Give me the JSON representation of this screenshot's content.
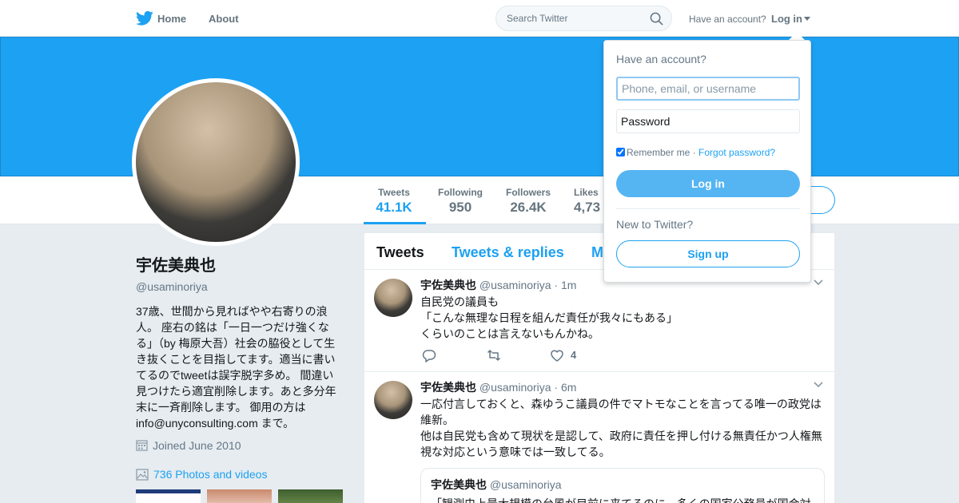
{
  "colors": {
    "brand": "#1da1f2",
    "banner": "#1da1f2",
    "text": "#14171a",
    "muted": "#657786"
  },
  "nav": {
    "logo_icon": "twitter-bird-icon",
    "home": "Home",
    "about": "About",
    "search_placeholder": "Search Twitter",
    "have_account": "Have an account?",
    "login": "Log in"
  },
  "profile": {
    "name": "宇佐美典也",
    "handle": "@usaminoriya",
    "bio": "37歳、世間から見ればやや右寄りの浪人。 座右の銘は「一日一つだけ強くなる」（by 梅原大吾）社会の脇役として生き抜くことを目指してます。適当に書いてるのでtweetは誤字脱字多め。 間違い見つけたら適宜削除します。あと多分年末に一斉削除します。 御用の方は info@unyconsulting.com まで。",
    "joined": "Joined June 2010",
    "photos": "736 Photos and videos"
  },
  "stats": [
    {
      "label": "Tweets",
      "value": "41.1K"
    },
    {
      "label": "Following",
      "value": "950"
    },
    {
      "label": "Followers",
      "value": "26.4K"
    },
    {
      "label": "Likes",
      "value": "4,73"
    }
  ],
  "tabs": [
    "Tweets",
    "Tweets & replies",
    "M"
  ],
  "tweets": [
    {
      "name": "宇佐美典也",
      "handle": "@usaminoriya",
      "time": "· 1m",
      "lines": [
        "自民党の議員も",
        "「こんな無理な日程を組んだ責任が我々にもある」",
        "くらいのことは言えないもんかね。"
      ],
      "likes": "4"
    },
    {
      "name": "宇佐美典也",
      "handle": "@usaminoriya",
      "time": "· 6m",
      "lines": [
        "一応付言しておくと、森ゆうこ議員の件でマトモなことを言ってる唯一の政党は維新。",
        "他は自民党も含めて現状を是認して、政府に責任を押し付ける無責任かつ人権無視な対応という意味では一致してる。"
      ],
      "quote": {
        "name": "宇佐美典也",
        "handle": "@usaminoriya",
        "text": "「観測史上最大規模の台風が目前に来てるのに、多くの国家公務員が国会対"
      }
    }
  ],
  "login_dropdown": {
    "title": "Have an account?",
    "user_placeholder": "Phone, email, or username",
    "password_placeholder": "Password",
    "remember": "Remember me",
    "separator": " · ",
    "forgot": "Forgot password?",
    "login_button": "Log in",
    "new_to": "New to Twitter?",
    "signup_button": "Sign up"
  }
}
